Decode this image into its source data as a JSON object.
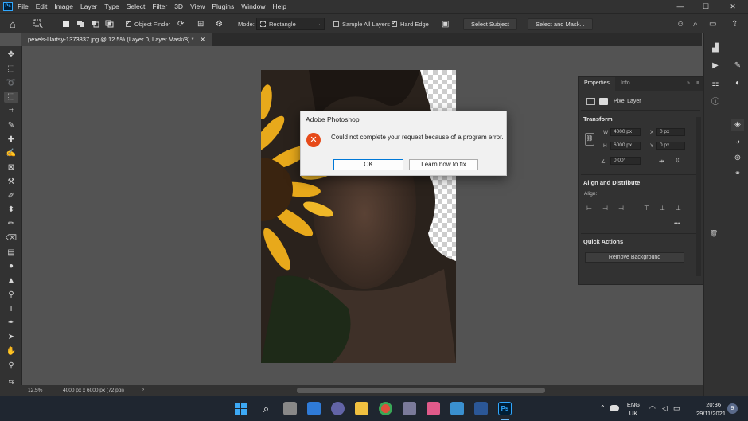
{
  "app": {
    "logo": "Ps",
    "menu": [
      "File",
      "Edit",
      "Image",
      "Layer",
      "Type",
      "Select",
      "Filter",
      "3D",
      "View",
      "Plugins",
      "Window",
      "Help"
    ]
  },
  "window_controls": {
    "minimize": "—",
    "maximize": "☐",
    "close": "✕"
  },
  "options_bar": {
    "object_finder_label": "Object Finder",
    "mode_label": "Mode:",
    "mode_value": "Rectangle",
    "sample_all_layers_label": "Sample All Layers",
    "hard_edge_label": "Hard Edge",
    "select_subject_label": "Select Subject",
    "select_and_mask_label": "Select and Mask..."
  },
  "document": {
    "tab_title": "pexels-lilartsy-1373837.jpg @ 12.5% (Layer 0, Layer Mask/8) *",
    "close_glyph": "✕"
  },
  "dialog": {
    "title": "Adobe Photoshop",
    "message": "Could not complete your request because of a program error.",
    "ok_label": "OK",
    "learn_label": "Learn how to fix",
    "error_glyph": "✕"
  },
  "properties": {
    "tab_properties": "Properties",
    "tab_info": "Info",
    "layer_type": "Pixel Layer",
    "transform_label": "Transform",
    "w_label": "W",
    "w_value": "4000 px",
    "h_label": "H",
    "h_value": "6000 px",
    "x_label": "X",
    "x_value": "0 px",
    "y_label": "Y",
    "y_value": "0 px",
    "angle_value": "0.00°",
    "align_label": "Align and Distribute",
    "align_sub": "Align:",
    "quick_actions_label": "Quick Actions",
    "remove_background_label": "Remove Background",
    "more_glyph": "•••"
  },
  "status": {
    "zoom": "12.5%",
    "dimensions": "4000 px x 6000 px (72 ppi)",
    "arrow": "›"
  },
  "taskbar": {
    "language_top": "ENG",
    "language_bottom": "UK",
    "time": "20:36",
    "date": "29/11/2021",
    "notifications": "9",
    "ps_label": "Ps"
  },
  "colors": {
    "dialog_error": "#e64a19",
    "ps_blue": "#31a8ff",
    "sunflower": "#e8a91b"
  }
}
